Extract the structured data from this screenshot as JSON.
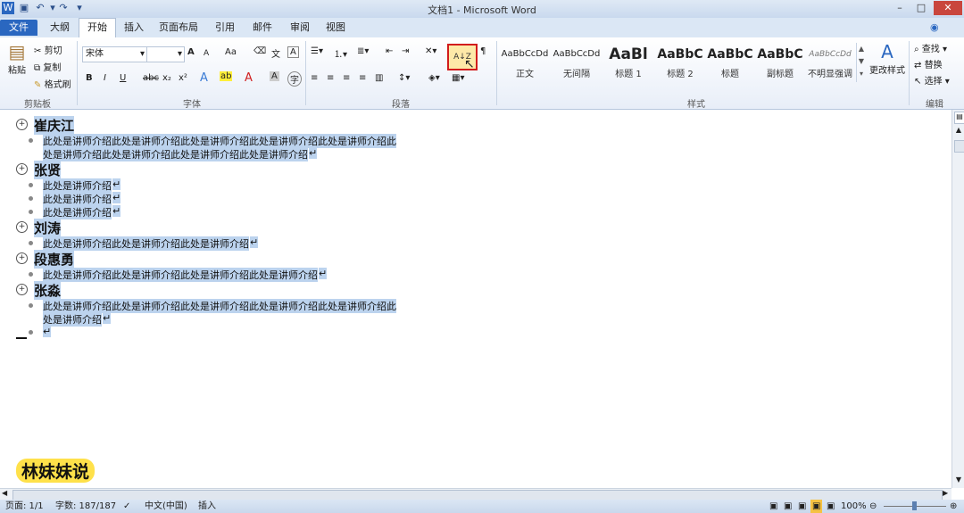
{
  "window": {
    "title": "文档1 - Microsoft Word",
    "word_icon": "W",
    "min_glyph": "–",
    "max_glyph": "□",
    "close_glyph": "✕"
  },
  "tabs": [
    "文件",
    "大纲",
    "开始",
    "插入",
    "页面布局",
    "引用",
    "邮件",
    "审阅",
    "视图"
  ],
  "ribbon": {
    "clipboard": {
      "paste": "粘贴",
      "cut": "剪切",
      "copy": "复制",
      "format_painter": "格式刷",
      "label": "剪贴板"
    },
    "font": {
      "name": "宋体",
      "size": "",
      "label": "字体",
      "bold": "B",
      "italic": "I",
      "underline": "U",
      "strike": "abc",
      "sub": "x₂",
      "sup": "x²",
      "grow": "A",
      "shrink": "A",
      "case": "Aa"
    },
    "paragraph": {
      "label": "段落"
    },
    "styles": {
      "label": "样式",
      "items": [
        {
          "preview": "AaBbCcDd",
          "name": "正文"
        },
        {
          "preview": "AaBbCcDd",
          "name": "无间隔"
        },
        {
          "preview": "AaBl",
          "name": "标题 1"
        },
        {
          "preview": "AaBbC",
          "name": "标题 2"
        },
        {
          "preview": "AaBbC",
          "name": "标题"
        },
        {
          "preview": "AaBbC",
          "name": "副标题"
        },
        {
          "preview": "AaBbCcDd",
          "name": "不明显强调"
        }
      ],
      "change_styles": "更改样式"
    },
    "editing": {
      "find": "查找",
      "replace": "替换",
      "select": "选择",
      "label": "编辑"
    },
    "sort_icon": "A↓Z"
  },
  "document": {
    "sections": [
      {
        "heading": "崔庆江",
        "lines": [
          "此处是讲师介绍此处是讲师介绍此处是讲师介绍此处是讲师介绍此处是讲师介绍此",
          "处是讲师介绍此处是讲师介绍此处是讲师介绍此处是讲师介绍"
        ]
      },
      {
        "heading": "张贤",
        "lines": [
          "此处是讲师介绍",
          "此处是讲师介绍",
          "此处是讲师介绍"
        ]
      },
      {
        "heading": "刘涛",
        "lines": [
          "此处是讲师介绍此处是讲师介绍此处是讲师介绍"
        ]
      },
      {
        "heading": "段惠勇",
        "lines": [
          "此处是讲师介绍此处是讲师介绍此处是讲师介绍此处是讲师介绍"
        ]
      },
      {
        "heading": "张淼",
        "lines": [
          "此处是讲师介绍此处是讲师介绍此处是讲师介绍此处是讲师介绍此处是讲师介绍此",
          "处是讲师介绍"
        ]
      }
    ],
    "para_mark": "↵"
  },
  "watermark": "林妹妹说",
  "status": {
    "page": "页面: 1/1",
    "words": "字数: 187/187",
    "language": "中文(中国)",
    "mode": "插入",
    "zoom": "100%"
  }
}
